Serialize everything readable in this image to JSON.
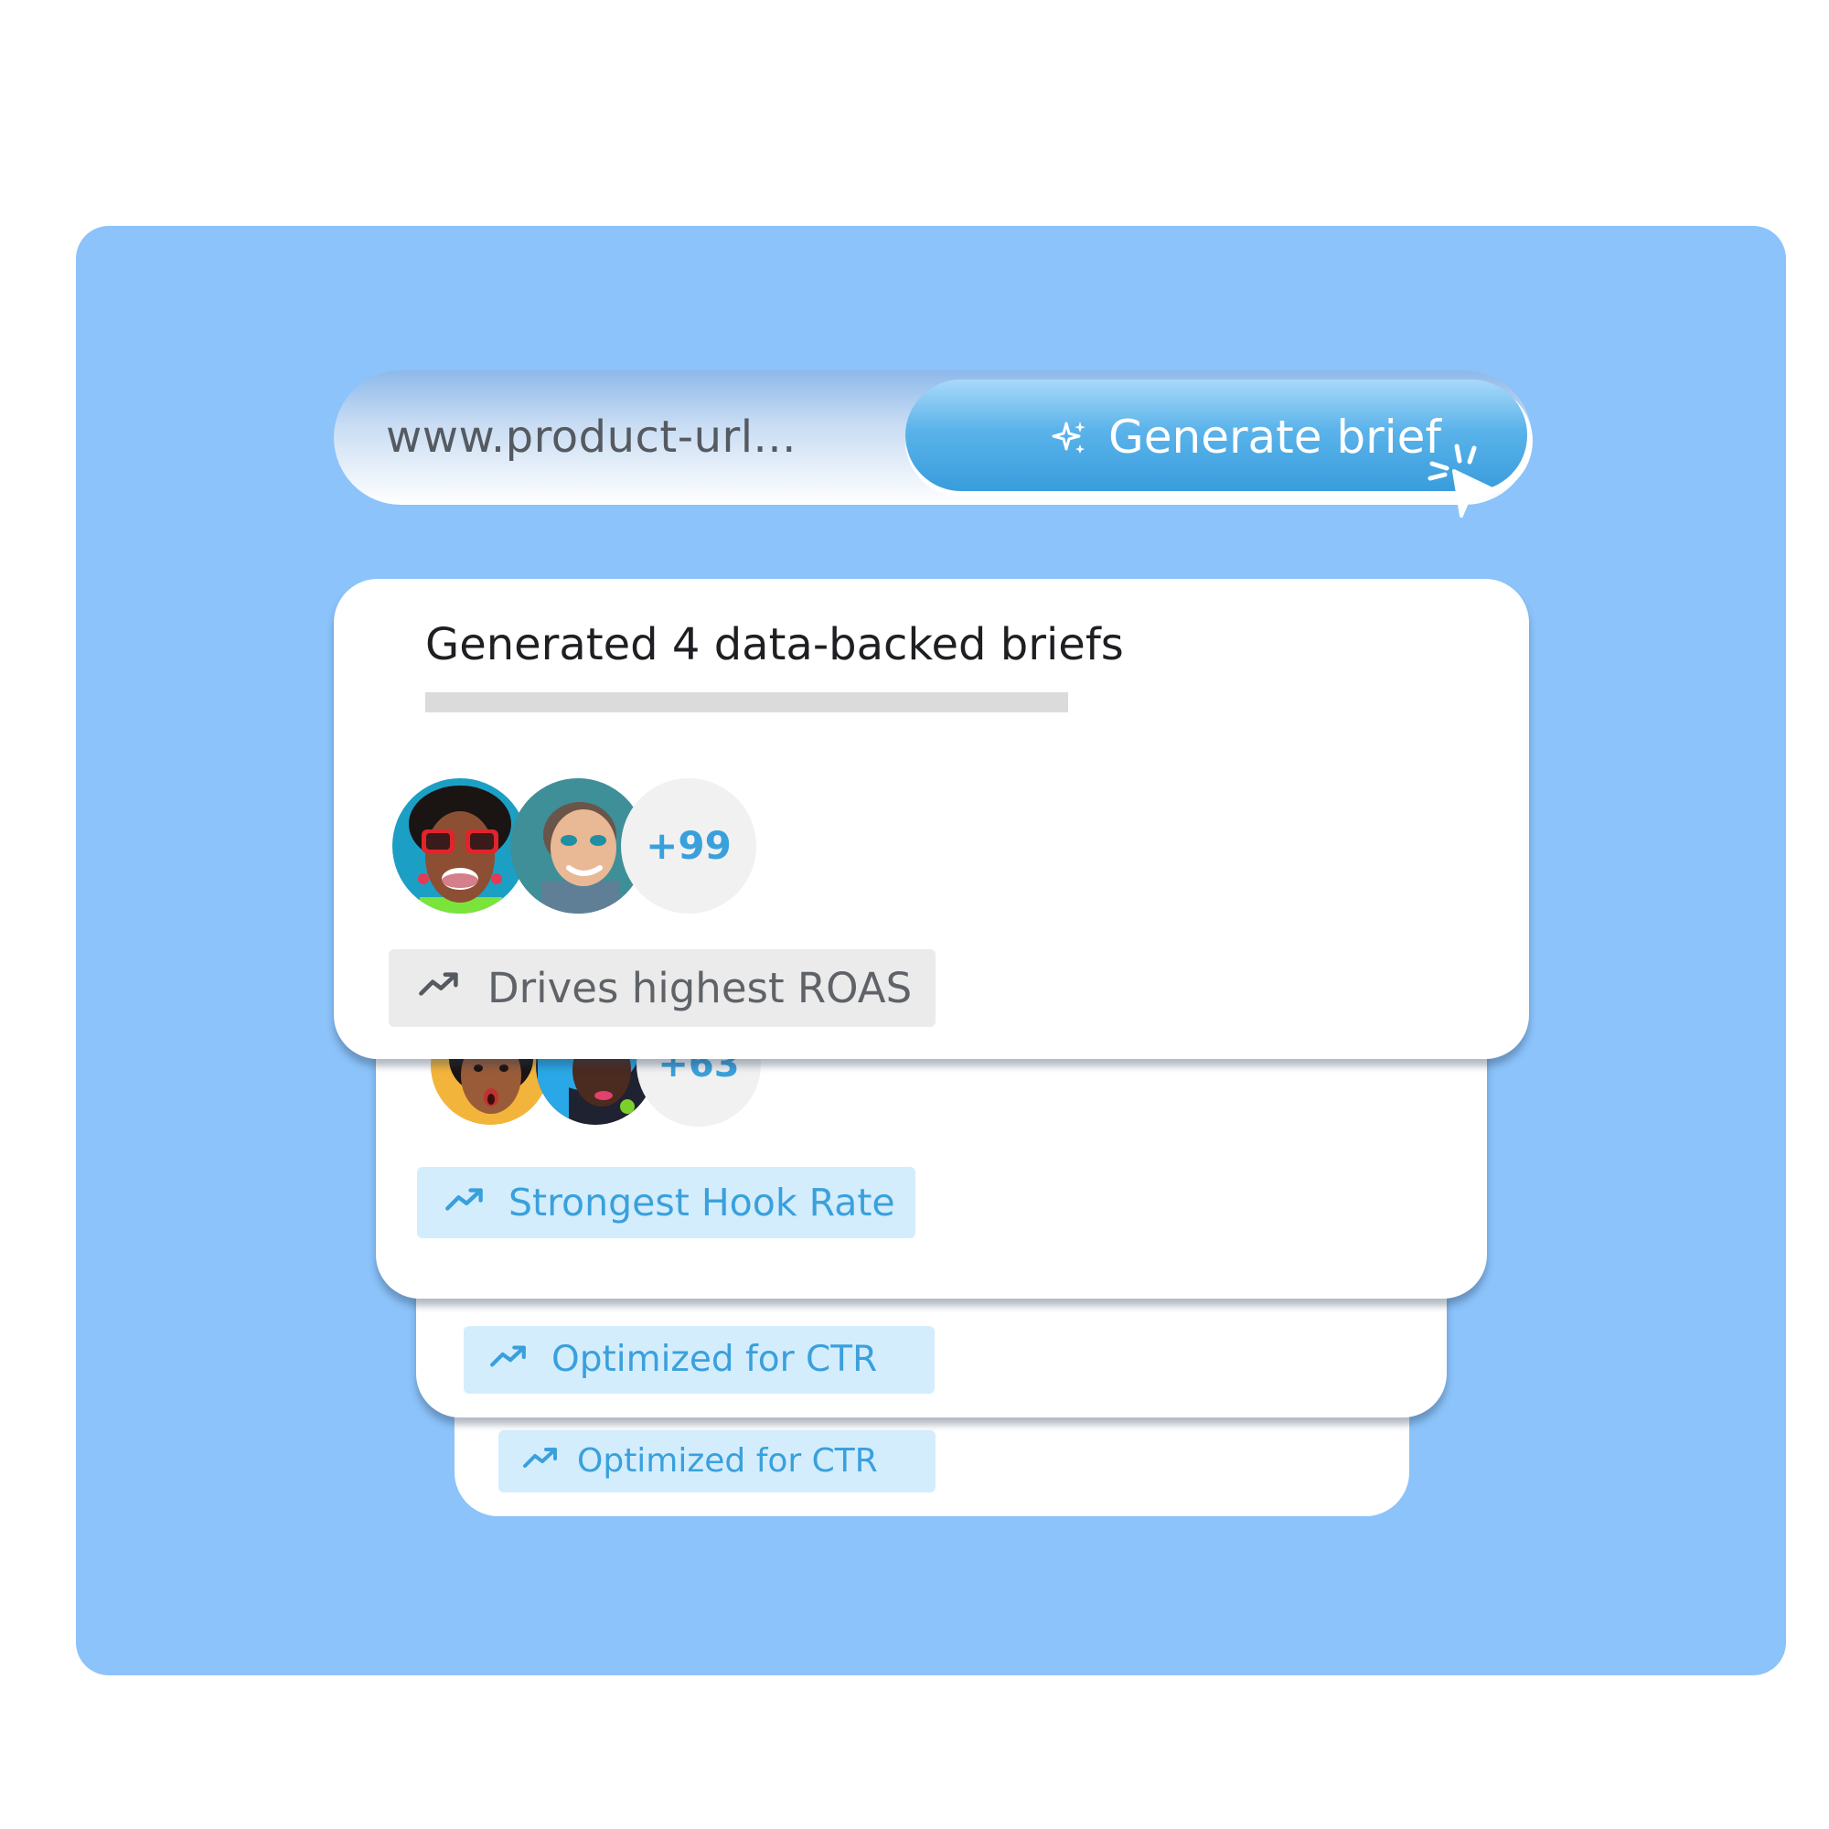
{
  "search": {
    "url_text": "www.product-url...",
    "button_label": "Generate brief"
  },
  "results": {
    "title": "Generated 4 data-backed briefs",
    "cards": [
      {
        "extra_count": "+99",
        "tag": "Drives highest ROAS"
      },
      {
        "extra_count": "+63",
        "tag": "Strongest Hook Rate"
      },
      {
        "tag": "Optimized for CTR"
      },
      {
        "tag": "Optimized for CTR"
      }
    ]
  },
  "colors": {
    "panel": "#8bc3fa",
    "accent": "#3aa0dc",
    "tag_blue_bg": "#d3edfd",
    "tag_gray_bg": "#ebebeb"
  },
  "icons": [
    "sparkle-icon",
    "cursor-click-icon",
    "trending-up-icon"
  ]
}
